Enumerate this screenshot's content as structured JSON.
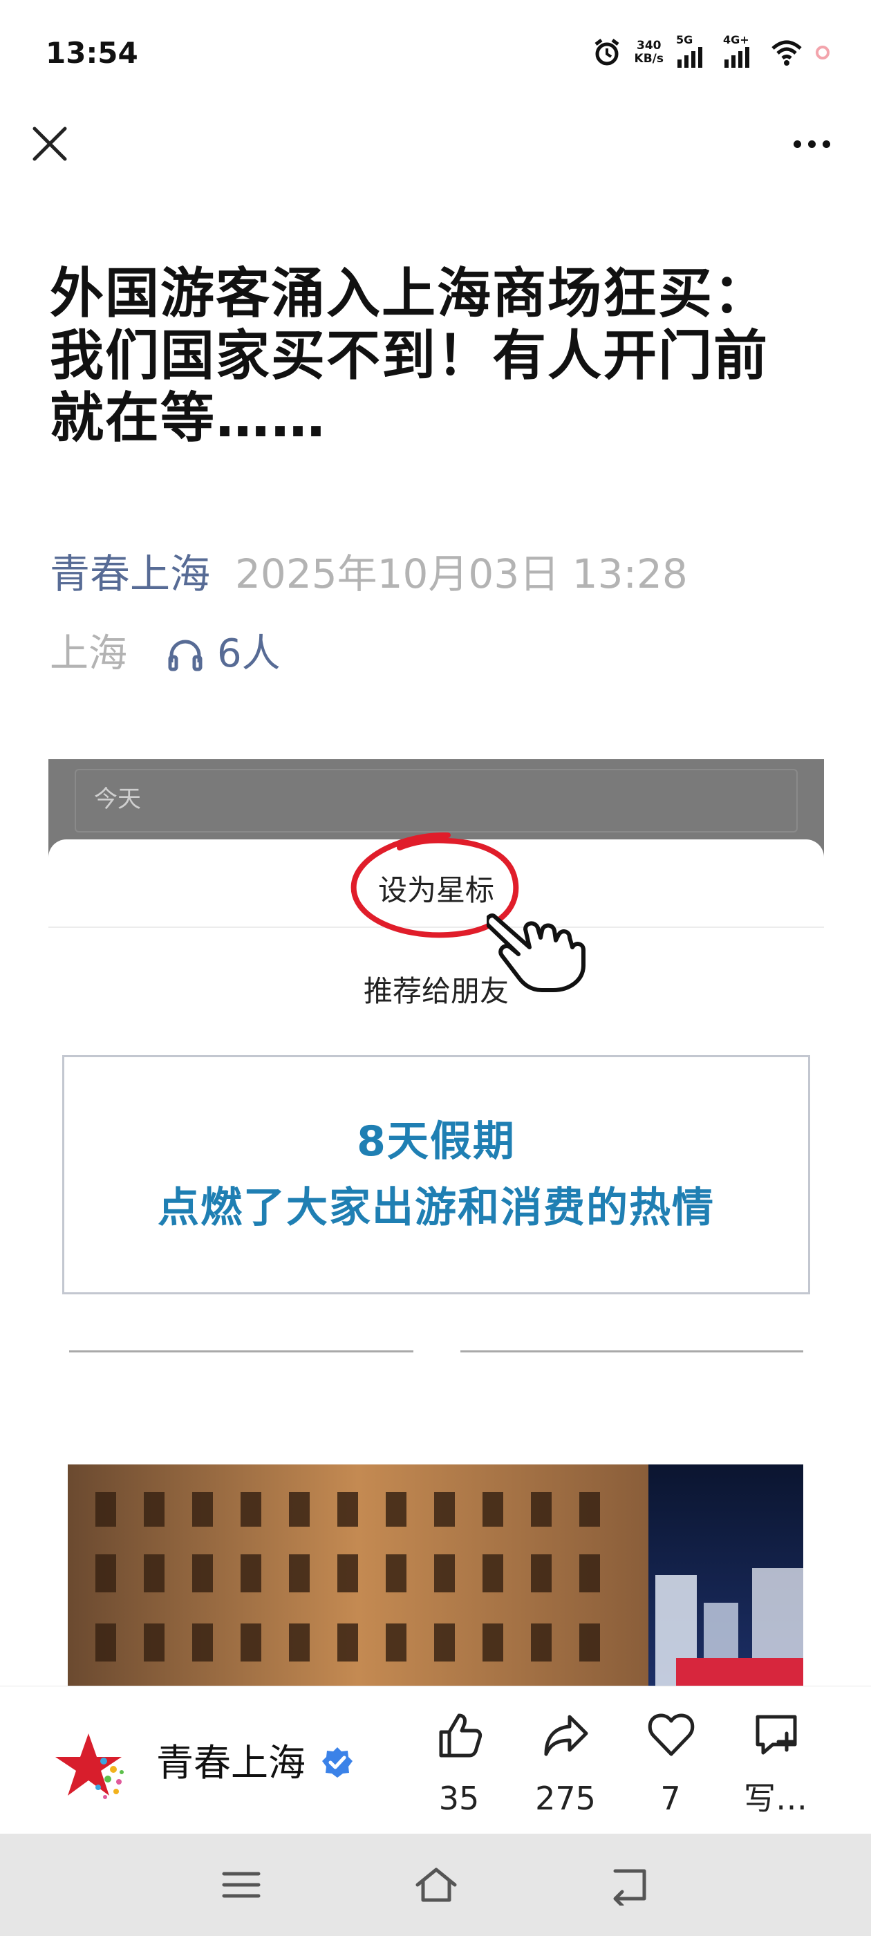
{
  "status_bar": {
    "time": "13:54",
    "net_speed_value": "340",
    "net_speed_unit": "KB/s",
    "signal1_label": "5G",
    "signal2_label": "4G+"
  },
  "article": {
    "title": "外国游客涌入上海商场狂买：我们国家买不到！有人开门前就在等……",
    "author": "青春上海",
    "date": "2025年10月03日 13:28",
    "region": "上海",
    "listeners": "6人"
  },
  "embed": {
    "today_label": "今天",
    "star_label": "设为星标",
    "recommend_label": "推荐给朋友",
    "card_line1": "8天假期",
    "card_line2": "点燃了大家出游和消费的热情"
  },
  "toolbar": {
    "account_name": "青春上海",
    "like_count": "35",
    "share_count": "275",
    "favorite_count": "7",
    "comment_label": "写…"
  },
  "colors": {
    "link_blue": "#576b95",
    "card_blue": "#1f7fb3",
    "muted_gray": "#b3b3b3",
    "circle_red": "#e01d2a"
  },
  "icons": [
    "close-icon",
    "more-icon",
    "headphones-icon",
    "like-icon",
    "share-icon",
    "heart-icon",
    "comment-icon",
    "verified-icon",
    "menu-icon",
    "home-icon",
    "back-icon"
  ]
}
